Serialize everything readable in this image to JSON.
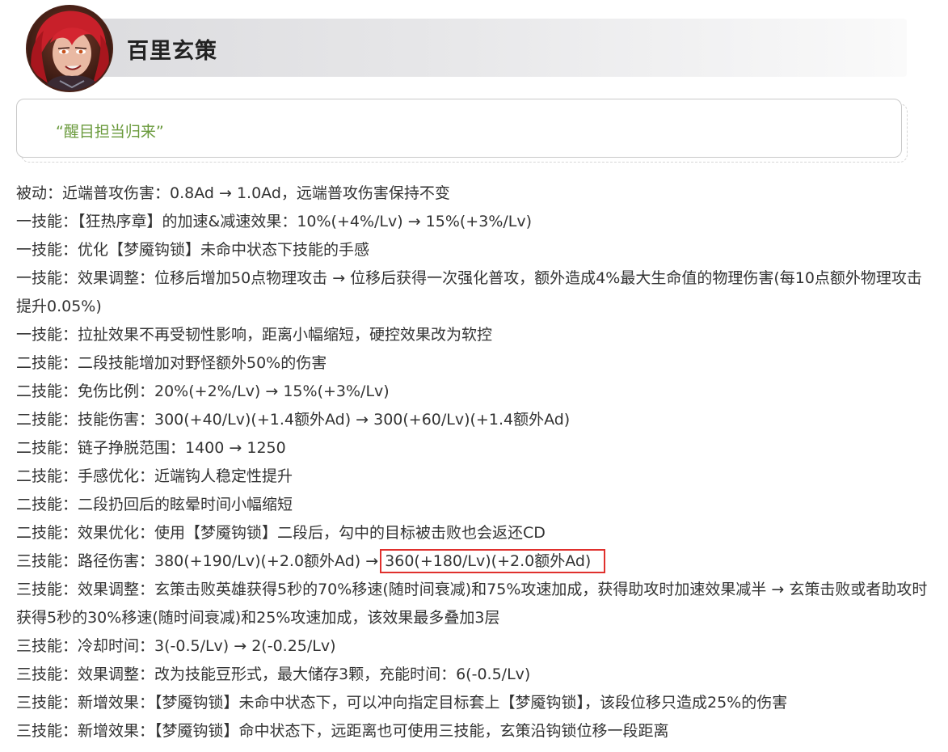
{
  "hero": {
    "name": "百里玄策"
  },
  "quote": "“醒目担当归来”",
  "changes": [
    {
      "text": "被动：近端普攻伤害：0.8Ad → 1.0Ad，远端普攻伤害保持不变"
    },
    {
      "text": "一技能：【狂热序章】的加速&减速效果：10%(+4%/Lv) → 15%(+3%/Lv)"
    },
    {
      "text": "一技能：优化【梦魇钩锁】未命中状态下技能的手感"
    },
    {
      "text": "一技能：效果调整：位移后增加50点物理攻击 → 位移后获得一次强化普攻，额外造成4%最大生命值的物理伤害(每10点额外物理攻击提升0.05%)"
    },
    {
      "text": "一技能：拉扯效果不再受韧性影响，距离小幅缩短，硬控效果改为软控"
    },
    {
      "text": "二技能：二段技能增加对野怪额外50%的伤害"
    },
    {
      "text": "二技能：免伤比例：20%(+2%/Lv) → 15%(+3%/Lv)"
    },
    {
      "text": "二技能：技能伤害：300(+40/Lv)(+1.4额外Ad) → 300(+60/Lv)(+1.4额外Ad)"
    },
    {
      "text": "二技能：链子挣脱范围：1400 → 1250"
    },
    {
      "text": "二技能：手感优化：近端钩人稳定性提升"
    },
    {
      "text": "二技能：二段扔回后的眩晕时间小幅缩短"
    },
    {
      "text": "二技能：效果优化：使用【梦魇钩锁】二段后，勾中的目标被击败也会返还CD"
    },
    {
      "text": "三技能：路径伤害：380(+190/Lv)(+2.0额外Ad) →",
      "highlight": "360(+180/Lv)(+2.0额外Ad)"
    },
    {
      "text": "三技能：效果调整：玄策击败英雄获得5秒的70%移速(随时间衰减)和75%攻速加成，获得助攻时加速效果减半 → 玄策击败或者助攻时获得5秒的30%移速(随时间衰减)和25%攻速加成，该效果最多叠加3层"
    },
    {
      "text": "三技能：冷却时间：3(-0.5/Lv) → 2(-0.25/Lv)"
    },
    {
      "text": "三技能：效果调整：改为技能豆形式，最大储存3颗，充能时间：6(-0.5/Lv)"
    },
    {
      "text": "三技能：新增效果：【梦魇钩锁】未命中状态下，可以冲向指定目标套上【梦魇钩锁】，该段位移只造成25%的伤害"
    },
    {
      "text": "三技能：新增效果：【梦魇钩锁】命中状态下，远距离也可使用三技能，玄策沿钩锁位移一段距离"
    }
  ]
}
